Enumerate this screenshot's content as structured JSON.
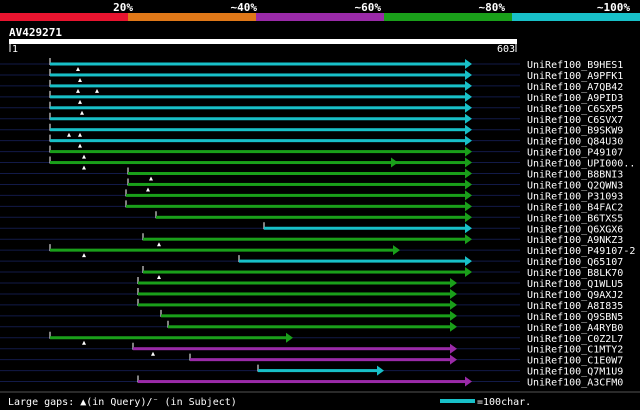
{
  "legend": {
    "percent_labels": [
      "20%",
      "~40%",
      "~60%",
      "~80%",
      "~100%"
    ],
    "colors": [
      "#e8142f",
      "#e07818",
      "#9a2aa8",
      "#1a9f1a",
      "#18c0c8"
    ]
  },
  "query": {
    "id": "AV429271",
    "start_label": "1",
    "end_label": "603"
  },
  "footer": {
    "gaps_text": "Large gaps: ▲(in Query)/⁻ (in Subject)",
    "scale_text": "=100char."
  },
  "hits": [
    {
      "name": "UniRef100_B9HES1",
      "color": "cyan",
      "start": 50,
      "end": 470,
      "gaps": [
        78
      ]
    },
    {
      "name": "UniRef100_A9PFK1",
      "color": "cyan",
      "start": 50,
      "end": 470,
      "gaps": [
        80
      ]
    },
    {
      "name": "UniRef100_A7QB42",
      "color": "cyan",
      "start": 50,
      "end": 470,
      "gaps": [
        78,
        97
      ]
    },
    {
      "name": "UniRef100_A9PID3",
      "color": "cyan",
      "start": 50,
      "end": 470,
      "gaps": [
        80
      ]
    },
    {
      "name": "UniRef100_C6SXP5",
      "color": "cyan",
      "start": 50,
      "end": 470,
      "gaps": [
        82
      ]
    },
    {
      "name": "UniRef100_C6SVX7",
      "color": "cyan",
      "start": 50,
      "end": 470,
      "gaps": []
    },
    {
      "name": "UniRef100_B9SKW9",
      "color": "cyan",
      "start": 50,
      "end": 470,
      "gaps": [
        69,
        80
      ]
    },
    {
      "name": "UniRef100_Q84U30",
      "color": "cyan",
      "start": 50,
      "end": 470,
      "gaps": [
        80
      ]
    },
    {
      "name": "UniRef100_P49107",
      "color": "green",
      "start": 50,
      "end": 470,
      "gaps": [
        84
      ]
    },
    {
      "name": "UniRef100_UPI000..",
      "color": "green",
      "start": 50,
      "end": 470,
      "gaps": [
        84
      ],
      "mid_arrow": 396
    },
    {
      "name": "UniRef100_B8BNI3",
      "color": "green",
      "start": 128,
      "end": 470,
      "gaps": [
        151
      ]
    },
    {
      "name": "UniRef100_Q2QWN3",
      "color": "green",
      "start": 128,
      "end": 470,
      "gaps": [
        148
      ]
    },
    {
      "name": "UniRef100_P31093",
      "color": "green",
      "start": 126,
      "end": 470,
      "gaps": []
    },
    {
      "name": "UniRef100_B4FAC2",
      "color": "green",
      "start": 126,
      "end": 470,
      "gaps": []
    },
    {
      "name": "UniRef100_B6TXS5",
      "color": "green",
      "start": 156,
      "end": 470,
      "gaps": []
    },
    {
      "name": "UniRef100_Q6XGX6",
      "color": "cyan",
      "start": 264,
      "end": 470,
      "gaps": []
    },
    {
      "name": "UniRef100_A9NKZ3",
      "color": "green",
      "start": 143,
      "end": 470,
      "gaps": [
        159
      ]
    },
    {
      "name": "UniRef100_P49107-2",
      "color": "green",
      "start": 50,
      "end": 398,
      "gaps": [
        84
      ]
    },
    {
      "name": "UniRef100_Q65107",
      "color": "cyan",
      "start": 239,
      "end": 470,
      "gaps": []
    },
    {
      "name": "UniRef100_B8LK70",
      "color": "green",
      "start": 143,
      "end": 470,
      "gaps": [
        159
      ]
    },
    {
      "name": "UniRef100_Q1WLU5",
      "color": "green",
      "start": 138,
      "end": 455,
      "gaps": []
    },
    {
      "name": "UniRef100_Q9AXJ2",
      "color": "green",
      "start": 138,
      "end": 455,
      "gaps": []
    },
    {
      "name": "UniRef100_A8I835",
      "color": "green",
      "start": 138,
      "end": 455,
      "gaps": []
    },
    {
      "name": "UniRef100_Q9SBN5",
      "color": "green",
      "start": 161,
      "end": 455,
      "gaps": []
    },
    {
      "name": "UniRef100_A4RYB0",
      "color": "green",
      "start": 168,
      "end": 455,
      "gaps": []
    },
    {
      "name": "UniRef100_C0Z2L7",
      "color": "green",
      "start": 50,
      "end": 291,
      "gaps": [
        84
      ]
    },
    {
      "name": "UniRef100_C1MTY2",
      "color": "purple",
      "start": 133,
      "end": 455,
      "gaps": [
        153
      ]
    },
    {
      "name": "UniRef100_C1E0W7",
      "color": "purple",
      "start": 190,
      "end": 455,
      "gaps": []
    },
    {
      "name": "UniRef100_Q7M1U9",
      "color": "cyan",
      "start": 258,
      "end": 382,
      "gaps": []
    },
    {
      "name": "UniRef100_A3CFM0",
      "color": "purple",
      "start": 138,
      "end": 470,
      "gaps": []
    }
  ]
}
